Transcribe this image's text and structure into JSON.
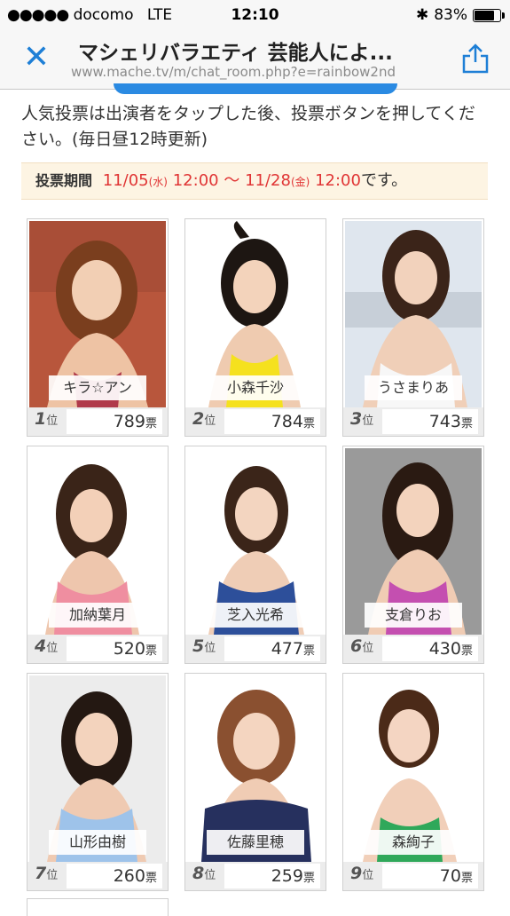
{
  "status": {
    "carrier": "docomo",
    "network": "LTE",
    "time": "12:10",
    "battery": "83%",
    "battery_level": 0.83
  },
  "nav": {
    "title": "マシェリバラエティ 芸能人によ...",
    "url": "www.mache.tv/m/chat_room.php?e=rainbow2nd"
  },
  "intro": "人気投票は出演者をタップした後、投票ボタンを押してください。(毎日昼12時更新)",
  "period": {
    "label": "投票期間",
    "start_date": "11/05",
    "start_dow": "(水)",
    "start_time": "12:00",
    "sep": "〜",
    "end_date": "11/28",
    "end_dow": "(金)",
    "end_time": "12:00",
    "suffix": "です。"
  },
  "colors": {
    "accent": "#1e7fd6",
    "period_red": "#e03535"
  },
  "rank_suffix": "位",
  "vote_suffix": "票",
  "candidates": [
    {
      "rank": "1",
      "name": "キラ☆アン",
      "votes": "789"
    },
    {
      "rank": "2",
      "name": "小森千沙",
      "votes": "784"
    },
    {
      "rank": "3",
      "name": "うさまりあ",
      "votes": "743"
    },
    {
      "rank": "4",
      "name": "加納葉月",
      "votes": "520"
    },
    {
      "rank": "5",
      "name": "芝入光希",
      "votes": "477"
    },
    {
      "rank": "6",
      "name": "支倉りお",
      "votes": "430"
    },
    {
      "rank": "7",
      "name": "山形由樹",
      "votes": "260"
    },
    {
      "rank": "8",
      "name": "佐藤里穂",
      "votes": "259"
    },
    {
      "rank": "9",
      "name": "森絢子",
      "votes": "70"
    }
  ]
}
